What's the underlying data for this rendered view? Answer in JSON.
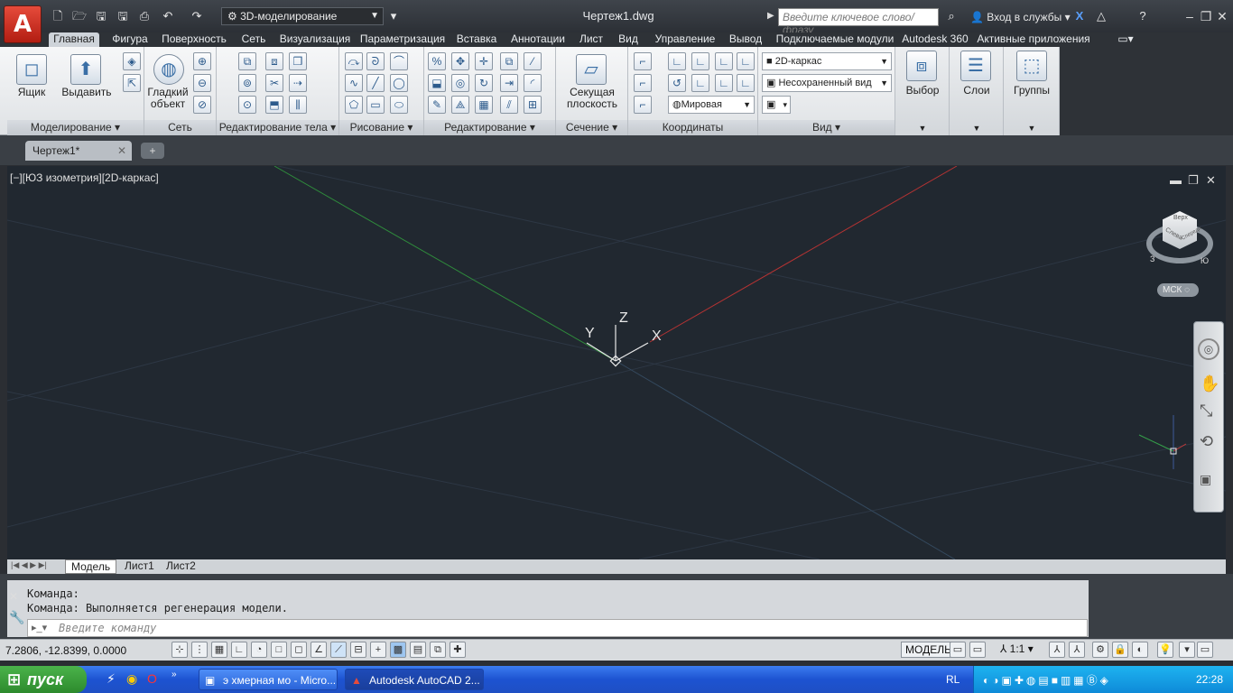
{
  "app": {
    "workspace": "3D-моделирование",
    "doc_title": "Чертеж1.dwg",
    "search_placeholder": "Введите ключевое слово/фразу",
    "login": "Вход в службы"
  },
  "menu": [
    "Главная",
    "Фигура",
    "Поверхность",
    "Сеть",
    "Визуализация",
    "Параметризация",
    "Вставка",
    "Аннотации",
    "Лист",
    "Вид",
    "Управление",
    "Вывод",
    "Подключаемые модули",
    "Autodesk 360",
    "Активные приложения"
  ],
  "ribbon": {
    "modeling": {
      "title": "Моделирование ▾",
      "box": "Ящик",
      "extrude": "Выдавить"
    },
    "mesh": {
      "title": "Сеть",
      "smooth": "Гладкий объект"
    },
    "solid_edit": {
      "title": "Редактирование тела ▾"
    },
    "draw": {
      "title": "Рисование ▾"
    },
    "modify": {
      "title": "Редактирование ▾"
    },
    "section": {
      "title": "Сечение ▾",
      "plane": "Секущая плоскость"
    },
    "coords": {
      "title": "Координаты",
      "world": "Мировая"
    },
    "view": {
      "title": "Вид ▾",
      "visual_style": "2D-каркас",
      "named_view": "Несохраненный вид"
    },
    "selection": {
      "label": "Выбор"
    },
    "layers": {
      "label": "Слои"
    },
    "groups": {
      "label": "Группы"
    }
  },
  "doc_tab": "Чертеж1*",
  "viewport": {
    "label": "[−][ЮЗ изометрия][2D-каркас]",
    "axis_x": "X",
    "axis_y": "Y",
    "axis_z": "Z",
    "viewcube": {
      "top": "Верх",
      "left": "Слева",
      "front": "Спереди",
      "ucs": "МСК",
      "compass_w": "З",
      "compass_s": "Ю"
    }
  },
  "layout_tabs": [
    "Модель",
    "Лист1",
    "Лист2"
  ],
  "command": {
    "line1": "Команда:",
    "line2": "Команда:  Выполняется регенерация модели.",
    "placeholder": "Введите команду"
  },
  "status": {
    "coords": "7.2806, -12.8399, 0.0000",
    "model": "МОДЕЛЬ",
    "scale": "1:1"
  },
  "taskbar": {
    "start": "пуск",
    "tasks": [
      "э хмерная мо - Micro...",
      "Autodesk AutoCAD 2..."
    ],
    "lang": "RL",
    "time": "22:28"
  },
  "colors": {
    "viewport_bg": "#212830",
    "x_axis": "#c83a3a",
    "y_axis": "#35a04a",
    "ribbon_bg": "#eef0f2"
  }
}
